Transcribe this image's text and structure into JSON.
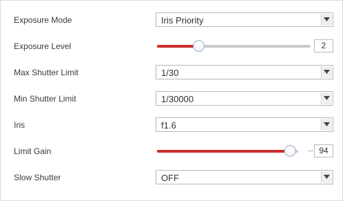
{
  "rows": [
    {
      "label": "Exposure Mode",
      "control": "select",
      "value": "Iris Priority"
    },
    {
      "label": "Exposure Level",
      "control": "slider",
      "value": "2",
      "fraction": 0.27
    },
    {
      "label": "Max Shutter Limit",
      "control": "select",
      "value": "1/30"
    },
    {
      "label": "Min Shutter Limit",
      "control": "select",
      "value": "1/30000"
    },
    {
      "label": "Iris",
      "control": "select",
      "value": "f1.6"
    },
    {
      "label": "Limit Gain",
      "control": "slider",
      "value": "94",
      "fraction": 0.94
    },
    {
      "label": "Slow Shutter",
      "control": "select",
      "value": "OFF"
    }
  ],
  "colors": {
    "slider_fill": "#cc2b2b",
    "slider_track": "#c9c9c9"
  },
  "icons": {
    "dropdown": "chevron-down-icon",
    "slider_knob": "slider-knob"
  }
}
